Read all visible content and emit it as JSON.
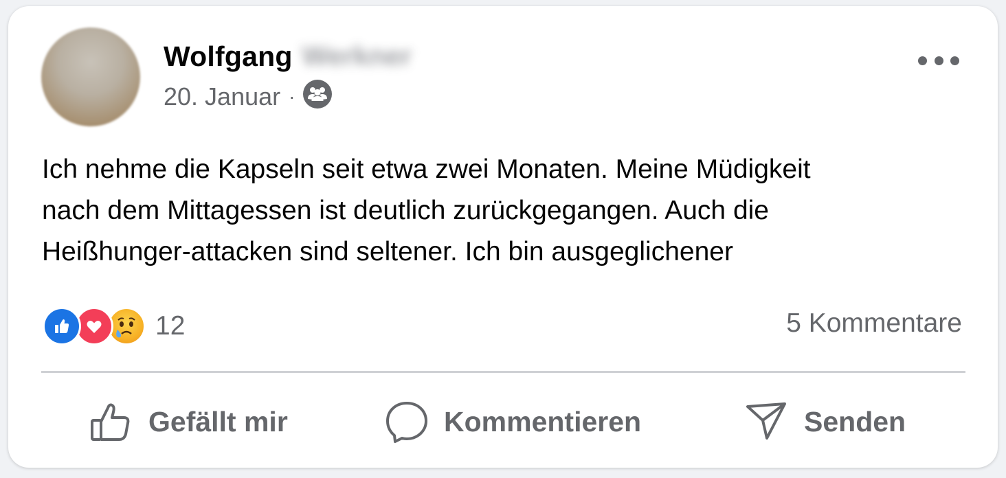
{
  "post": {
    "author_first_name": "Wolfgang",
    "author_last_name": "Werkner",
    "date": "20. Januar",
    "separator": "·",
    "audience_icon": "friends-icon",
    "text_lines": [
      "Ich nehme die Kapseln seit etwa zwei Monaten. Meine Müdigkeit",
      "nach dem Mittagessen ist deutlich zurückgegangen. Auch die",
      "Heißhunger-attacken sind seltener. Ich bin ausgeglichener"
    ]
  },
  "reactions": {
    "types": [
      "like",
      "love",
      "sad"
    ],
    "count": "12"
  },
  "comments": {
    "label": "5 Kommentare"
  },
  "actions": {
    "like_label": "Gefällt mir",
    "comment_label": "Kommentieren",
    "share_label": "Senden"
  },
  "colors": {
    "like_blue": "#1b74e4",
    "love_red": "#f33e58",
    "sad_yellow": "#f7b125",
    "secondary_text": "#65676b",
    "primary_text": "#050505"
  }
}
